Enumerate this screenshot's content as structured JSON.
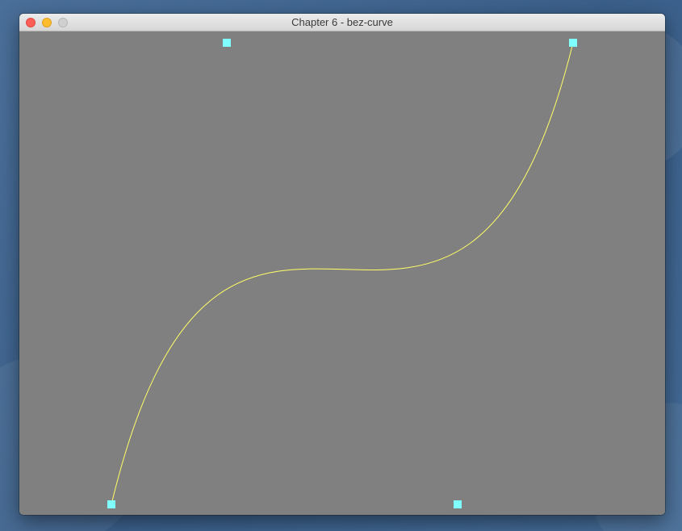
{
  "window": {
    "title": "Chapter 6 - bez-curve"
  },
  "canvas": {
    "background": "#808080",
    "curve_color": "#ffff66",
    "control_point_color": "#80ffff"
  },
  "icons": {
    "close": "close-button-icon",
    "minimize": "minimize-button-icon",
    "zoom": "zoom-button-icon"
  }
}
